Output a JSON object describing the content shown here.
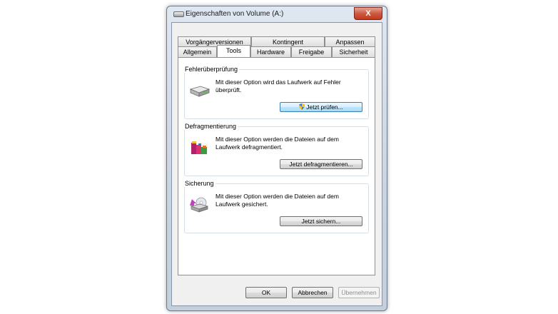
{
  "window": {
    "title": "Eigenschaften von Volume (A:)",
    "close_label": "X"
  },
  "tabs": {
    "row1": [
      "Vorgängerversionen",
      "Kontingent",
      "Anpassen"
    ],
    "row2": [
      "Allgemein",
      "Tools",
      "Hardware",
      "Freigabe",
      "Sicherheit"
    ],
    "active": "Tools"
  },
  "groups": {
    "check": {
      "label": "Fehlerüberprüfung",
      "text": "Mit dieser Option wird das Laufwerk auf Fehler überprüft.",
      "button": "Jetzt prüfen..."
    },
    "defrag": {
      "label": "Defragmentierung",
      "text": "Mit dieser Option werden die Dateien auf dem Laufwerk defragmentiert.",
      "button": "Jetzt defragmentieren..."
    },
    "backup": {
      "label": "Sicherung",
      "text": "Mit dieser Option werden die Dateien auf dem Laufwerk gesichert.",
      "button": "Jetzt sichern..."
    }
  },
  "footer": {
    "ok": "OK",
    "cancel": "Abbrechen",
    "apply": "Übernehmen"
  },
  "colors": {
    "titlebar": "#c9d4e2",
    "close": "#c2391c",
    "focus_button": "#bee6fd"
  }
}
